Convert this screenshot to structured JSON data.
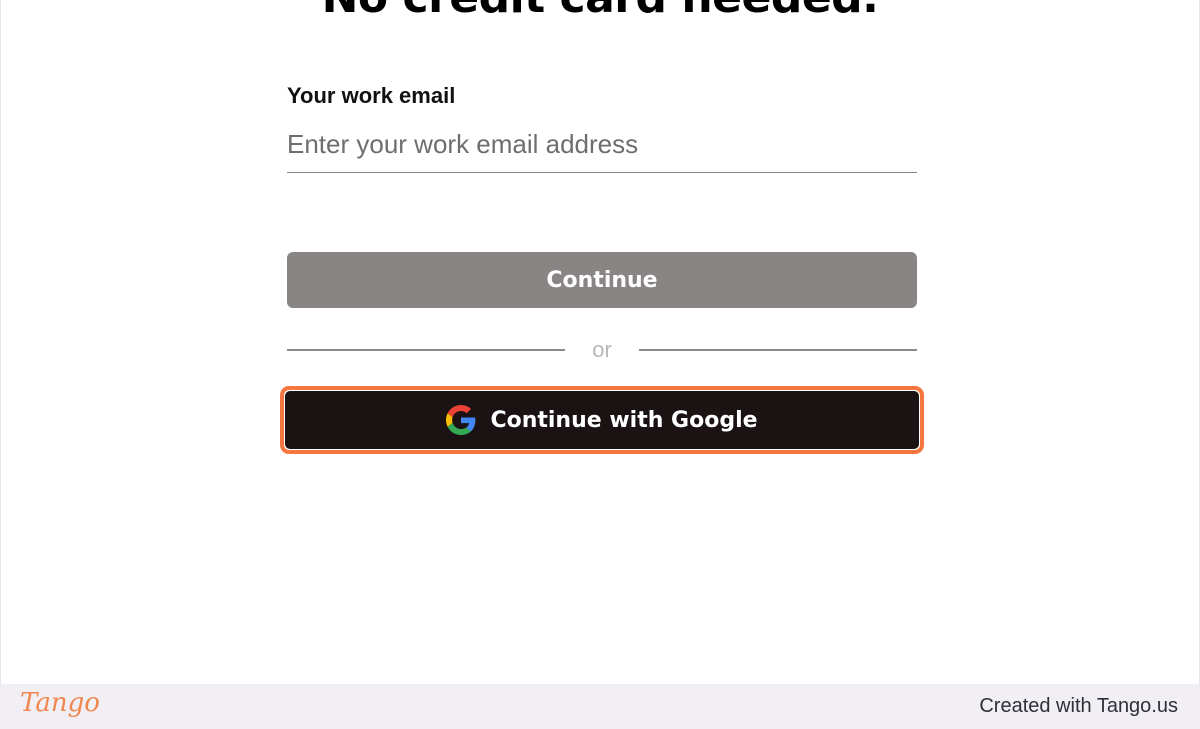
{
  "signup": {
    "heading": "No credit card needed.",
    "email_label": "Your work email",
    "email_placeholder": "Enter your work email address",
    "email_value": "",
    "continue_label": "Continue",
    "divider_text": "or",
    "google_label": "Continue with Google",
    "google_icon": "google-g-icon"
  },
  "footer": {
    "logo_text": "Tango",
    "credit_text": "Created with Tango.us"
  },
  "colors": {
    "highlight": "#f3773f",
    "continue_bg": "#898584",
    "google_bg": "#1a1213",
    "footer_bg": "#f1eff4",
    "logo": "#f0874f"
  }
}
